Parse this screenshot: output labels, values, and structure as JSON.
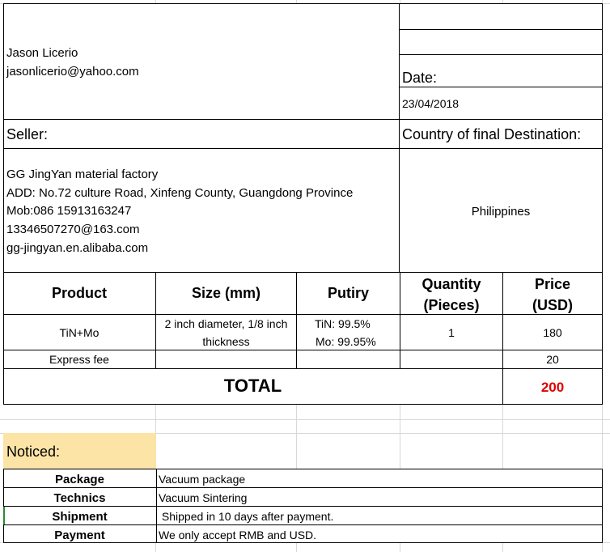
{
  "buyer": {
    "name": "Jason Licerio",
    "email": "jasonlicerio@yahoo.com"
  },
  "date": {
    "label": "Date:",
    "value": "23/04/2018"
  },
  "seller": {
    "label": "Seller:",
    "lines": [
      "GG JingYan material factory",
      "ADD: No.72 culture Road, Xinfeng County, Guangdong Province",
      "Mob:086 15913163247",
      "13346507270@163.com",
      "gg-jingyan.en.alibaba.com"
    ]
  },
  "destination": {
    "label": "Country of final Destination:",
    "value": "Philippines"
  },
  "table": {
    "headers": {
      "product": "Product",
      "size": "Size (mm)",
      "purity": "Putiry",
      "quantity_l1": "Quantity",
      "quantity_l2": "(Pieces)",
      "price_l1": "Price",
      "price_l2": "(USD)"
    },
    "rows": [
      {
        "product": "TiN+Mo",
        "size_l1": "2 inch diameter, 1/8 inch",
        "size_l2": "thickness",
        "purity_l1": "TiN: 99.5%",
        "purity_l2": "Mo: 99.95%",
        "quantity": "1",
        "price": "180"
      },
      {
        "product": "Express fee",
        "price": "20"
      }
    ],
    "total_label": "TOTAL",
    "total_value": "200"
  },
  "notice": {
    "label": "Noticed:",
    "items": [
      {
        "key": "Package",
        "value": "Vacuum package"
      },
      {
        "key": "Technics",
        "value": "Vacuum Sintering"
      },
      {
        "key": "Shipment",
        "value": " Shipped in 10 days after payment."
      },
      {
        "key": "Payment",
        "value": "We only accept RMB and USD."
      }
    ]
  },
  "colors": {
    "total_value": "#e00000",
    "notice_fill": "#fce4a6",
    "gridline": "#d8d8d8"
  }
}
